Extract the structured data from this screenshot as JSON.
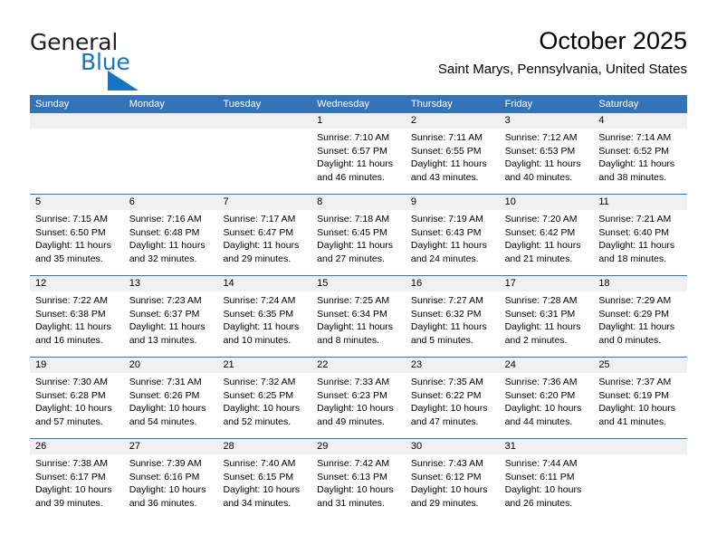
{
  "logo": {
    "word_one": "General",
    "word_two": "Blue",
    "triangle_icon": "triangle-icon",
    "brand_color": "#1773c4"
  },
  "header": {
    "title": "October 2025",
    "location": "Saint Marys, Pennsylvania, United States"
  },
  "calendar": {
    "accent_color": "#3573b9",
    "daynum_strip_color": "#f0f0f0",
    "weekdays": [
      "Sunday",
      "Monday",
      "Tuesday",
      "Wednesday",
      "Thursday",
      "Friday",
      "Saturday"
    ],
    "weeks": [
      [
        {
          "day": "",
          "lines": []
        },
        {
          "day": "",
          "lines": []
        },
        {
          "day": "",
          "lines": []
        },
        {
          "day": "1",
          "lines": [
            "Sunrise: 7:10 AM",
            "Sunset: 6:57 PM",
            "Daylight: 11 hours",
            "and 46 minutes."
          ]
        },
        {
          "day": "2",
          "lines": [
            "Sunrise: 7:11 AM",
            "Sunset: 6:55 PM",
            "Daylight: 11 hours",
            "and 43 minutes."
          ]
        },
        {
          "day": "3",
          "lines": [
            "Sunrise: 7:12 AM",
            "Sunset: 6:53 PM",
            "Daylight: 11 hours",
            "and 40 minutes."
          ]
        },
        {
          "day": "4",
          "lines": [
            "Sunrise: 7:14 AM",
            "Sunset: 6:52 PM",
            "Daylight: 11 hours",
            "and 38 minutes."
          ]
        }
      ],
      [
        {
          "day": "5",
          "lines": [
            "Sunrise: 7:15 AM",
            "Sunset: 6:50 PM",
            "Daylight: 11 hours",
            "and 35 minutes."
          ]
        },
        {
          "day": "6",
          "lines": [
            "Sunrise: 7:16 AM",
            "Sunset: 6:48 PM",
            "Daylight: 11 hours",
            "and 32 minutes."
          ]
        },
        {
          "day": "7",
          "lines": [
            "Sunrise: 7:17 AM",
            "Sunset: 6:47 PM",
            "Daylight: 11 hours",
            "and 29 minutes."
          ]
        },
        {
          "day": "8",
          "lines": [
            "Sunrise: 7:18 AM",
            "Sunset: 6:45 PM",
            "Daylight: 11 hours",
            "and 27 minutes."
          ]
        },
        {
          "day": "9",
          "lines": [
            "Sunrise: 7:19 AM",
            "Sunset: 6:43 PM",
            "Daylight: 11 hours",
            "and 24 minutes."
          ]
        },
        {
          "day": "10",
          "lines": [
            "Sunrise: 7:20 AM",
            "Sunset: 6:42 PM",
            "Daylight: 11 hours",
            "and 21 minutes."
          ]
        },
        {
          "day": "11",
          "lines": [
            "Sunrise: 7:21 AM",
            "Sunset: 6:40 PM",
            "Daylight: 11 hours",
            "and 18 minutes."
          ]
        }
      ],
      [
        {
          "day": "12",
          "lines": [
            "Sunrise: 7:22 AM",
            "Sunset: 6:38 PM",
            "Daylight: 11 hours",
            "and 16 minutes."
          ]
        },
        {
          "day": "13",
          "lines": [
            "Sunrise: 7:23 AM",
            "Sunset: 6:37 PM",
            "Daylight: 11 hours",
            "and 13 minutes."
          ]
        },
        {
          "day": "14",
          "lines": [
            "Sunrise: 7:24 AM",
            "Sunset: 6:35 PM",
            "Daylight: 11 hours",
            "and 10 minutes."
          ]
        },
        {
          "day": "15",
          "lines": [
            "Sunrise: 7:25 AM",
            "Sunset: 6:34 PM",
            "Daylight: 11 hours",
            "and 8 minutes."
          ]
        },
        {
          "day": "16",
          "lines": [
            "Sunrise: 7:27 AM",
            "Sunset: 6:32 PM",
            "Daylight: 11 hours",
            "and 5 minutes."
          ]
        },
        {
          "day": "17",
          "lines": [
            "Sunrise: 7:28 AM",
            "Sunset: 6:31 PM",
            "Daylight: 11 hours",
            "and 2 minutes."
          ]
        },
        {
          "day": "18",
          "lines": [
            "Sunrise: 7:29 AM",
            "Sunset: 6:29 PM",
            "Daylight: 11 hours",
            "and 0 minutes."
          ]
        }
      ],
      [
        {
          "day": "19",
          "lines": [
            "Sunrise: 7:30 AM",
            "Sunset: 6:28 PM",
            "Daylight: 10 hours",
            "and 57 minutes."
          ]
        },
        {
          "day": "20",
          "lines": [
            "Sunrise: 7:31 AM",
            "Sunset: 6:26 PM",
            "Daylight: 10 hours",
            "and 54 minutes."
          ]
        },
        {
          "day": "21",
          "lines": [
            "Sunrise: 7:32 AM",
            "Sunset: 6:25 PM",
            "Daylight: 10 hours",
            "and 52 minutes."
          ]
        },
        {
          "day": "22",
          "lines": [
            "Sunrise: 7:33 AM",
            "Sunset: 6:23 PM",
            "Daylight: 10 hours",
            "and 49 minutes."
          ]
        },
        {
          "day": "23",
          "lines": [
            "Sunrise: 7:35 AM",
            "Sunset: 6:22 PM",
            "Daylight: 10 hours",
            "and 47 minutes."
          ]
        },
        {
          "day": "24",
          "lines": [
            "Sunrise: 7:36 AM",
            "Sunset: 6:20 PM",
            "Daylight: 10 hours",
            "and 44 minutes."
          ]
        },
        {
          "day": "25",
          "lines": [
            "Sunrise: 7:37 AM",
            "Sunset: 6:19 PM",
            "Daylight: 10 hours",
            "and 41 minutes."
          ]
        }
      ],
      [
        {
          "day": "26",
          "lines": [
            "Sunrise: 7:38 AM",
            "Sunset: 6:17 PM",
            "Daylight: 10 hours",
            "and 39 minutes."
          ]
        },
        {
          "day": "27",
          "lines": [
            "Sunrise: 7:39 AM",
            "Sunset: 6:16 PM",
            "Daylight: 10 hours",
            "and 36 minutes."
          ]
        },
        {
          "day": "28",
          "lines": [
            "Sunrise: 7:40 AM",
            "Sunset: 6:15 PM",
            "Daylight: 10 hours",
            "and 34 minutes."
          ]
        },
        {
          "day": "29",
          "lines": [
            "Sunrise: 7:42 AM",
            "Sunset: 6:13 PM",
            "Daylight: 10 hours",
            "and 31 minutes."
          ]
        },
        {
          "day": "30",
          "lines": [
            "Sunrise: 7:43 AM",
            "Sunset: 6:12 PM",
            "Daylight: 10 hours",
            "and 29 minutes."
          ]
        },
        {
          "day": "31",
          "lines": [
            "Sunrise: 7:44 AM",
            "Sunset: 6:11 PM",
            "Daylight: 10 hours",
            "and 26 minutes."
          ]
        },
        {
          "day": "",
          "lines": []
        }
      ]
    ]
  }
}
